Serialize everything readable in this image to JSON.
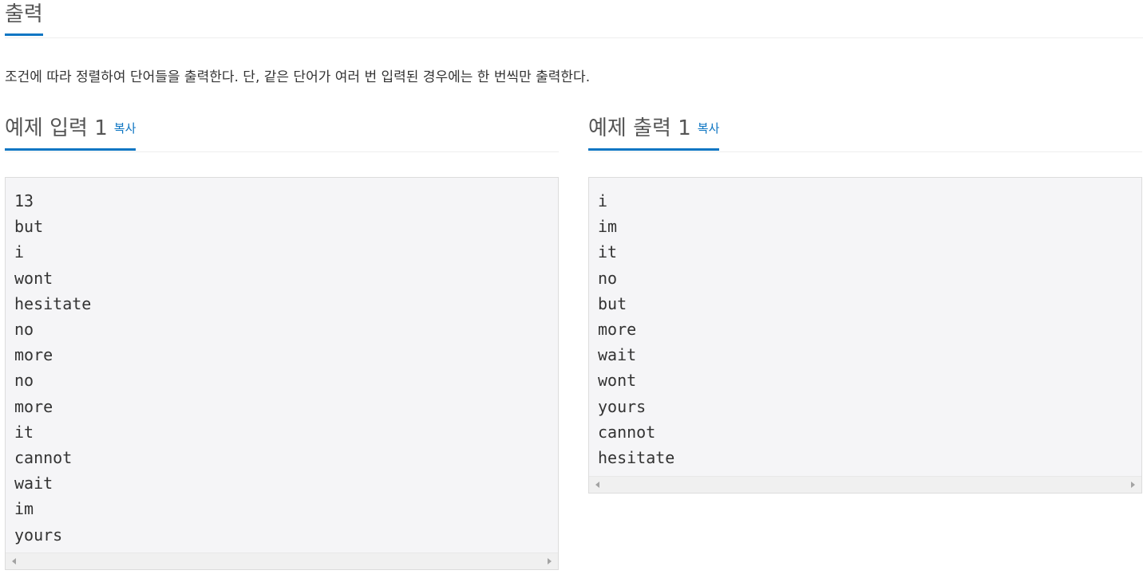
{
  "output_section": {
    "title": "출력",
    "description": "조건에 따라 정렬하여 단어들을 출력한다. 단, 같은 단어가 여러 번 입력된 경우에는 한 번씩만 출력한다."
  },
  "sample_input": {
    "title": "예제 입력 1",
    "copy_label": "복사",
    "text": "13\nbut\ni\nwont\nhesitate\nno\nmore\nno\nmore\nit\ncannot\nwait\nim\nyours"
  },
  "sample_output": {
    "title": "예제 출력 1",
    "copy_label": "복사",
    "text": "i\nim\nit\nno\nbut\nmore\nwait\nwont\nyours\ncannot\nhesitate"
  },
  "colors": {
    "accent": "#0e76c3",
    "sample_background": "#f5f5f7"
  }
}
